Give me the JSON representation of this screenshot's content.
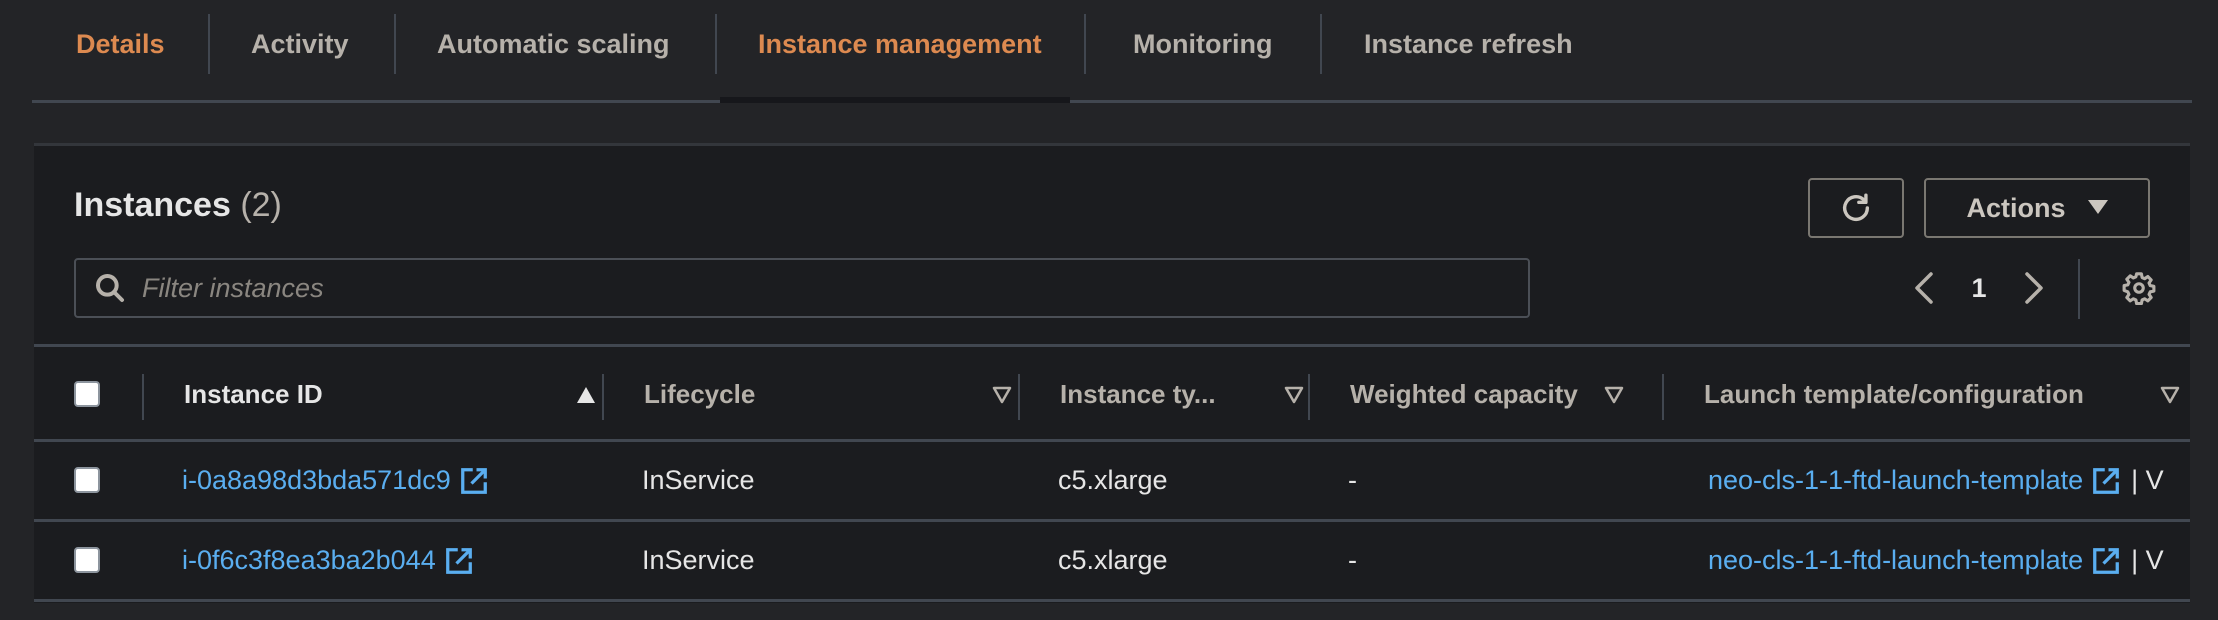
{
  "tabs": [
    {
      "label": "Details",
      "active": true
    },
    {
      "label": "Activity",
      "active": false
    },
    {
      "label": "Automatic scaling",
      "active": false
    },
    {
      "label": "Instance management",
      "active": true
    },
    {
      "label": "Monitoring",
      "active": false
    },
    {
      "label": "Instance refresh",
      "active": false
    }
  ],
  "panel": {
    "title": "Instances",
    "count": "(2)",
    "refresh_icon": "refresh-icon",
    "actions_label": "Actions",
    "search_placeholder": "Filter instances",
    "search_value": "",
    "page": "1"
  },
  "table": {
    "columns": [
      {
        "label": "Instance ID",
        "sort": "ascending"
      },
      {
        "label": "Lifecycle",
        "sort": "none"
      },
      {
        "label": "Instance ty...",
        "sort": "none"
      },
      {
        "label": "Weighted capacity",
        "sort": "none"
      },
      {
        "label": "Launch template/configuration",
        "sort": "none"
      }
    ],
    "rows": [
      {
        "instance_id": "i-0a8a98d3bda571dc9",
        "lifecycle": "InService",
        "instance_type": "c5.xlarge",
        "weighted_capacity": "-",
        "launch_template": "neo-cls-1-1-ftd-launch-template",
        "trailing": "| V"
      },
      {
        "instance_id": "i-0f6c3f8ea3ba2b044",
        "lifecycle": "InService",
        "instance_type": "c5.xlarge",
        "weighted_capacity": "-",
        "launch_template": "neo-cls-1-1-ftd-launch-template",
        "trailing": "| V"
      }
    ]
  },
  "colors": {
    "accent": "#dd8a50",
    "link": "#5aaef0",
    "background": "#232427",
    "panel": "#1b1c1f"
  }
}
